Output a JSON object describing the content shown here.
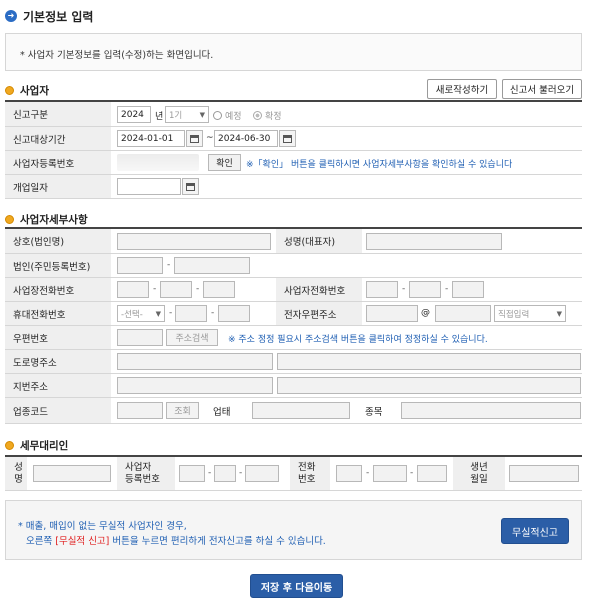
{
  "page": {
    "title": "기본정보 입력"
  },
  "notice": {
    "text": "* 사업자 기본정보를 입력(수정)하는 화면입니다."
  },
  "business": {
    "heading": "사업자",
    "btn_new": "새로작성하기",
    "btn_load": "신고서 불러오기",
    "report_type_label": "신고구분",
    "year": "2024",
    "year_unit": "년",
    "period_option": "1기",
    "radio_estimate": "예정",
    "radio_confirm": "확정",
    "period_label": "신고대상기간",
    "date_from": "2024-01-01",
    "date_sep": "~",
    "date_to": "2024-06-30",
    "biz_no_label": "사업자등록번호",
    "confirm_btn": "확인",
    "confirm_hint": "※「확인」 버튼을 클릭하시면 사업자세부사항을 확인하실 수 있습니다",
    "open_date_label": "개업일자"
  },
  "detail": {
    "heading": "사업자세부사항",
    "trade_name_label": "상호(법인명)",
    "rep_name_label": "성명(대표자)",
    "corp_no_label": "법인(주민등록번호)",
    "biz_phone_label": "사업장전화번호",
    "home_phone_label": "사업자전화번호",
    "mobile_label": "휴대전화번호",
    "mobile_select": "-선택-",
    "email_label": "전자우편주소",
    "email_at": "@",
    "email_domain_select": "직접입력",
    "zip_label": "우편번호",
    "zip_btn": "주소검색",
    "zip_hint": "※ 주소 정정 필요시 주소검색 버튼을 클릭하여 정정하실 수 있습니다.",
    "road_addr_label": "도로명주소",
    "lot_addr_label": "지번주소",
    "industry_code_label": "업종코드",
    "lookup_btn": "조회",
    "business_type_label": "업태",
    "item_label": "종목"
  },
  "agent": {
    "heading": "세무대리인",
    "name_label_1": "성",
    "name_label_2": "명",
    "reg_label_1": "사업자",
    "reg_label_2": "등록번호",
    "phone_label_1": "전화",
    "phone_label_2": "번호",
    "birth_label_1": "생년",
    "birth_label_2": "월일"
  },
  "footer": {
    "line1": "* 매출, 매입이 없는 무실적 사업자인 경우,",
    "line2_pre": "오른쪽 ",
    "line2_highlight": "[무실적 신고]",
    "line2_post": " 버튼을 누르면 편리하게 전자신고를 하실 수 있습니다.",
    "no_record_btn": "무실적신고",
    "save_btn": "저장 후 다음이동"
  },
  "colors": {
    "accent": "#2b5ea7",
    "section_dot": "#f0a820",
    "highlight_red": "#e02020",
    "hint_blue": "#1f5fb3"
  }
}
